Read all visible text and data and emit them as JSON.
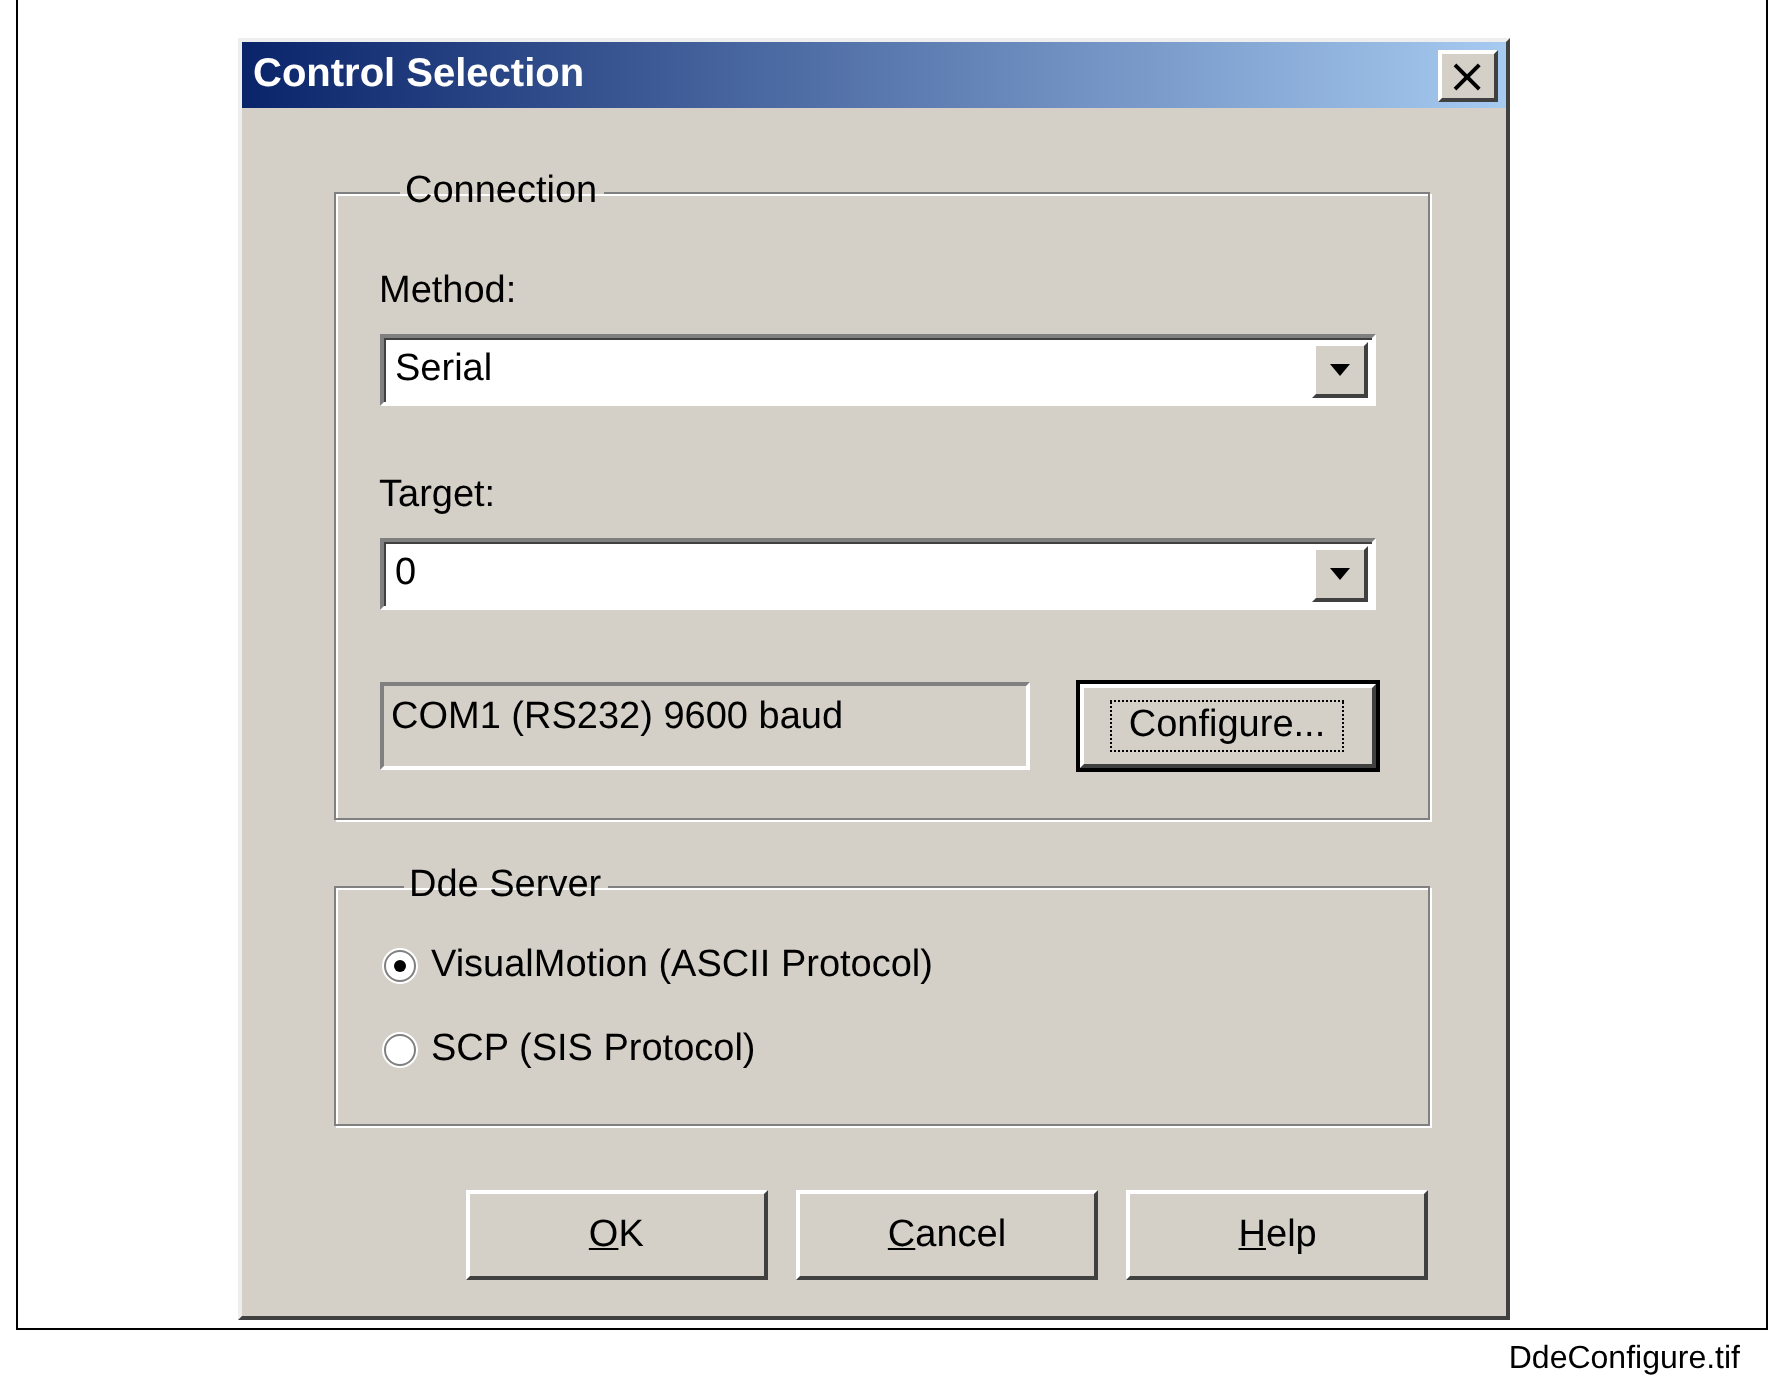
{
  "window": {
    "title": "Control Selection",
    "close": "×"
  },
  "connection": {
    "title": "Connection",
    "method": {
      "label": "Method:",
      "value": "Serial"
    },
    "target": {
      "label": "Target:",
      "value": "0"
    },
    "status": "COM1 (RS232) 9600 baud",
    "configure": {
      "label": "Configure...",
      "focused": true
    }
  },
  "dde_server": {
    "title": "Dde Server",
    "options": [
      {
        "label": "VisualMotion (ASCII Protocol)",
        "selected": true
      },
      {
        "label": "SCP (SIS Protocol)",
        "selected": false
      }
    ]
  },
  "buttons": [
    {
      "label": "OK",
      "underline_first": true
    },
    {
      "label": "Cancel",
      "underline_first": true
    },
    {
      "label": "Help",
      "underline_first": true
    }
  ],
  "caption": "DdeConfigure.tif"
}
